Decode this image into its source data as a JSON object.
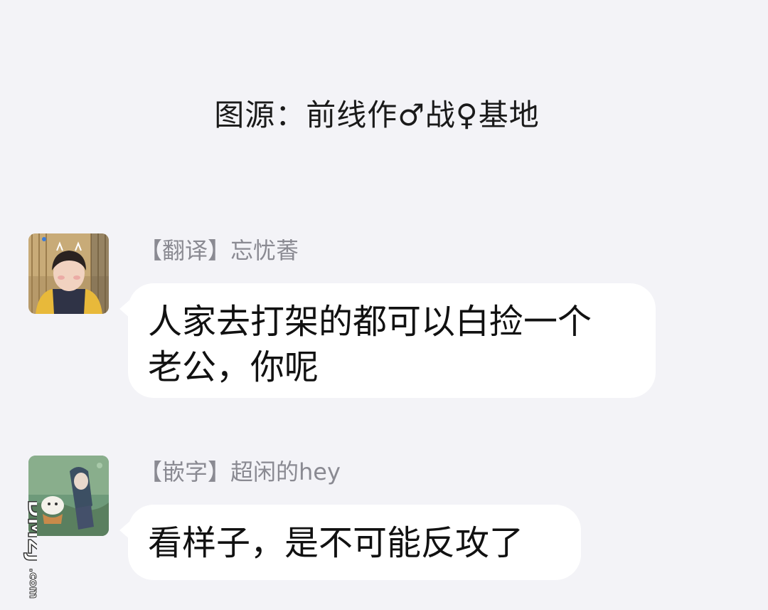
{
  "header": {
    "source_text": "图源：前线作♂战♀基地"
  },
  "messages": [
    {
      "sender": "【翻译】忘忧萫",
      "text_lines": [
        "人家去打架的都可以白捡一个",
        "老公，你呢"
      ]
    },
    {
      "sender": "【嵌字】超闲的hey",
      "text_lines": [
        "看样子，是不可能反攻了"
      ]
    }
  ],
  "watermark": {
    "text": "DMZJ.com"
  },
  "colors": {
    "background": "#f3f3f7",
    "bubble": "#ffffff",
    "sender_text": "#8a8a92",
    "message_text": "#111111"
  }
}
